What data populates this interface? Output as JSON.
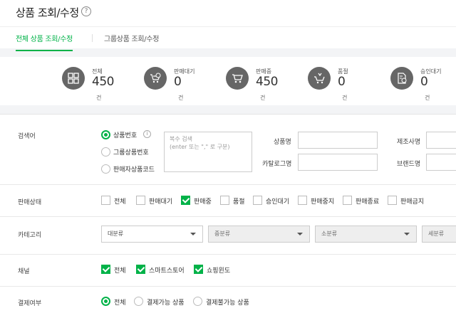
{
  "page": {
    "title": "상품 조회/수정",
    "help_icon": "?"
  },
  "tabs": [
    {
      "label": "전체 상품 조회/수정",
      "active": true
    },
    {
      "label": "그룹상품 조회/수정",
      "active": false
    }
  ],
  "stats": [
    {
      "label": "전체",
      "value": "450",
      "unit": "건",
      "icon": "grid-icon"
    },
    {
      "label": "판매대기",
      "value": "0",
      "unit": "건",
      "icon": "cart-clock-icon"
    },
    {
      "label": "판매중",
      "value": "450",
      "unit": "건",
      "icon": "cart-icon"
    },
    {
      "label": "품절",
      "value": "0",
      "unit": "건",
      "icon": "cart-out-icon"
    },
    {
      "label": "승인대기",
      "value": "0",
      "unit": "건",
      "icon": "document-clock-icon"
    }
  ],
  "search": {
    "label": "검색어",
    "options": [
      {
        "label": "상품번호",
        "selected": true
      },
      {
        "label": "그룹상품번호",
        "selected": false
      },
      {
        "label": "판매자상품코드",
        "selected": false
      }
    ],
    "info_icon": "i",
    "textarea_placeholder": "복수 검색\n(enter 또는 \",\" 로 구분)",
    "fields": [
      {
        "label": "상품명",
        "value": ""
      },
      {
        "label": "제조사명",
        "value": ""
      },
      {
        "label": "카탈로그명",
        "value": ""
      },
      {
        "label": "브랜드명",
        "value": ""
      }
    ]
  },
  "status": {
    "label": "판매상태",
    "options": [
      {
        "label": "전체",
        "checked": false
      },
      {
        "label": "판매대기",
        "checked": false
      },
      {
        "label": "판매중",
        "checked": true
      },
      {
        "label": "품절",
        "checked": false
      },
      {
        "label": "승인대기",
        "checked": false
      },
      {
        "label": "판매중지",
        "checked": false
      },
      {
        "label": "판매종료",
        "checked": false
      },
      {
        "label": "판매금지",
        "checked": false
      }
    ]
  },
  "category": {
    "label": "카테고리",
    "selects": [
      "대분류",
      "중분류",
      "소분류",
      "세분류"
    ]
  },
  "channel": {
    "label": "채널",
    "options": [
      {
        "label": "전체",
        "checked": true
      },
      {
        "label": "스마트스토어",
        "checked": true
      },
      {
        "label": "쇼핑윈도",
        "checked": true
      }
    ]
  },
  "payment": {
    "label": "결제여부",
    "options": [
      {
        "label": "전체",
        "selected": true
      },
      {
        "label": "결제가능 상품",
        "selected": false
      },
      {
        "label": "결제불가능 상품",
        "selected": false
      }
    ]
  },
  "colors": {
    "accent": "#00b248",
    "icon_bg": "#666666"
  }
}
